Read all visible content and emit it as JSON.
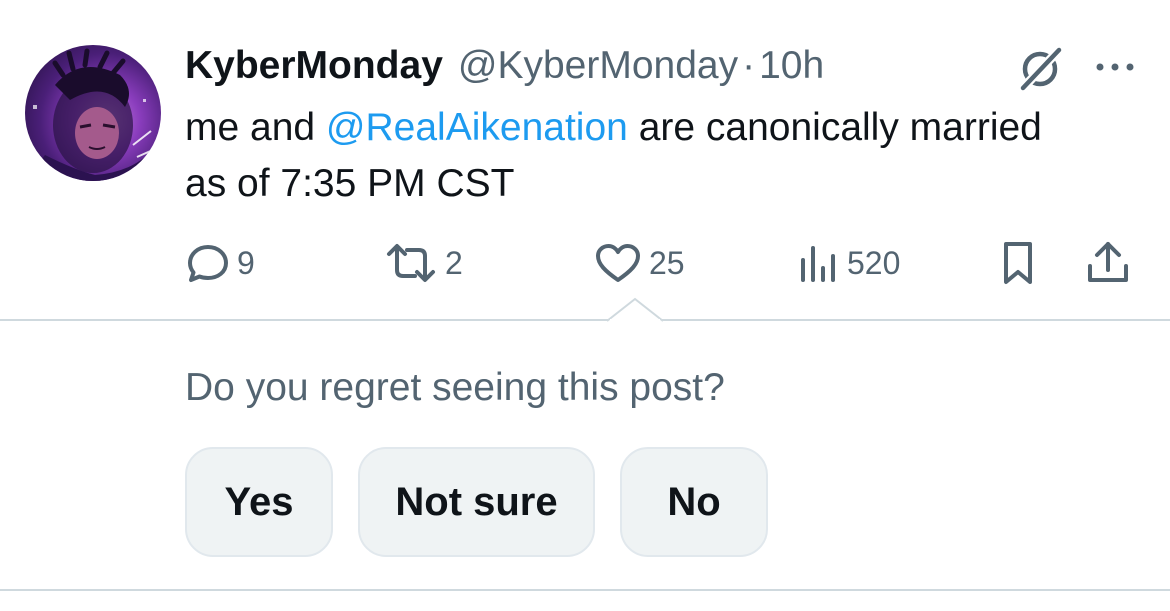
{
  "post": {
    "display_name": "KyberMonday",
    "handle": "@KyberMonday",
    "separator": "·",
    "time": "10h",
    "text_before": "me and ",
    "mention": "@RealAikenation",
    "text_after": " are canonically married as of 7:35 PM CST"
  },
  "actions": {
    "replies": "9",
    "reposts": "2",
    "likes": "25",
    "views": "520"
  },
  "feedback": {
    "question": "Do you regret seeing this post?",
    "options": [
      "Yes",
      "Not sure",
      "No"
    ]
  },
  "icons": {
    "reply": "reply-icon",
    "repost": "repost-icon",
    "like": "heart-icon",
    "views": "views-icon",
    "bookmark": "bookmark-icon",
    "share": "share-icon",
    "grok": "grok-icon",
    "more": "more-icon"
  },
  "colors": {
    "text": "#0f1419",
    "muted": "#536471",
    "mention": "#1d9bf0",
    "button_bg": "#eff3f4",
    "divider": "#cfd9de"
  }
}
